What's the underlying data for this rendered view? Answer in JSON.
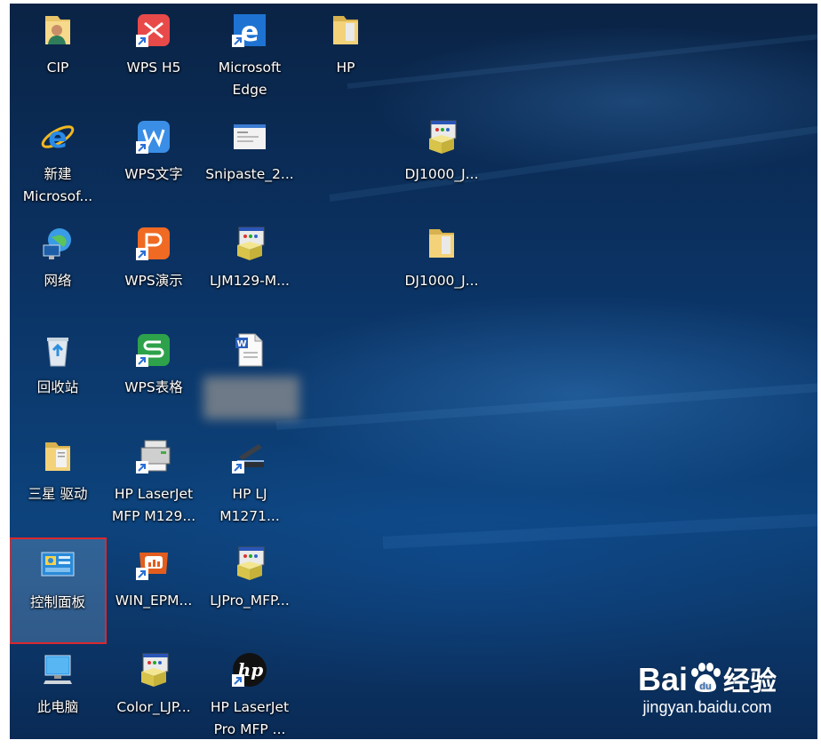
{
  "desktop": {
    "icons": [
      {
        "label": "CIP",
        "icon": "user-folder-icon"
      },
      {
        "label": "WPS H5",
        "icon": "wps-h5-icon"
      },
      {
        "label": "Microsoft\nEdge",
        "icon": "edge-icon"
      },
      {
        "label": "HP",
        "icon": "folder-icon"
      },
      {
        "label": "新建\nMicrosof...",
        "icon": "ie-icon"
      },
      {
        "label": "WPS文字",
        "icon": "wps-writer-icon"
      },
      {
        "label": "Snipaste_2...",
        "icon": "image-file-icon"
      },
      {
        "label": "DJ1000_J...",
        "icon": "installer-icon"
      },
      {
        "label": "网络",
        "icon": "network-icon"
      },
      {
        "label": "WPS演示",
        "icon": "wps-presentation-icon"
      },
      {
        "label": "LJM129-M...",
        "icon": "installer-icon"
      },
      {
        "label": "DJ1000_J...",
        "icon": "folder-icon"
      },
      {
        "label": "回收站",
        "icon": "recycle-bin-icon"
      },
      {
        "label": "WPS表格",
        "icon": "wps-spreadsheet-icon"
      },
      {
        "label": "",
        "icon": "word-document-icon"
      },
      {
        "label": "三星 驱动",
        "icon": "folder-icon"
      },
      {
        "label": "HP LaserJet\nMFP M129...",
        "icon": "printer-icon"
      },
      {
        "label": "HP LJ\nM1271...",
        "icon": "scanner-icon"
      },
      {
        "label": "控制面板",
        "icon": "control-panel-icon"
      },
      {
        "label": "WIN_EPM...",
        "icon": "presentation-app-icon"
      },
      {
        "label": "LJPro_MFP...",
        "icon": "installer-icon"
      },
      {
        "label": "此电脑",
        "icon": "computer-icon"
      },
      {
        "label": "Color_LJP...",
        "icon": "installer-icon"
      },
      {
        "label": "HP LaserJet\nPro MFP ...",
        "icon": "hp-logo-icon"
      }
    ],
    "selected_icon": "控制面板"
  },
  "watermark": {
    "brand": "Bai",
    "brand_suffix": "经验",
    "url": "jingyan.baidu.com"
  }
}
